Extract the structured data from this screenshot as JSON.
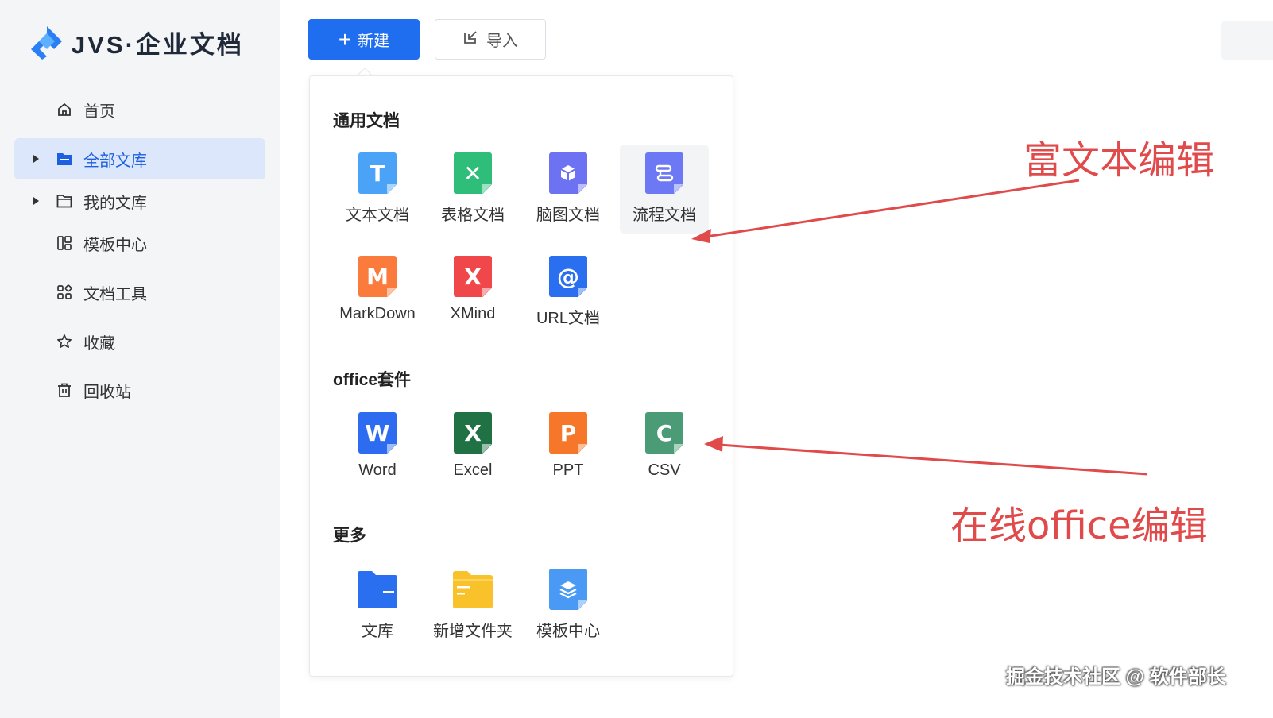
{
  "app": {
    "logo_text": "JVS·企业文档",
    "accent": "#1f6ef0"
  },
  "sidebar": {
    "items": [
      {
        "label": "首页",
        "icon": "home-icon"
      },
      {
        "label": "全部文库",
        "icon": "folder-filled-icon",
        "active": true
      },
      {
        "label": "我的文库",
        "icon": "folder-outline-icon"
      },
      {
        "label": "模板中心",
        "icon": "template-icon"
      },
      {
        "label": "文档工具",
        "icon": "tools-icon"
      },
      {
        "label": "收藏",
        "icon": "star-icon"
      },
      {
        "label": "回收站",
        "icon": "trash-icon"
      }
    ]
  },
  "toolbar": {
    "new_label": "新建",
    "new_icon": "+",
    "import_label": "导入"
  },
  "panel": {
    "sections": [
      {
        "title": "通用文档",
        "items": [
          {
            "label": "文本文档",
            "icon": "text-doc-icon",
            "color": "#4aa3f7"
          },
          {
            "label": "表格文档",
            "icon": "sheet-doc-icon",
            "color": "#2fbd7a"
          },
          {
            "label": "脑图文档",
            "icon": "mindmap-doc-icon",
            "color": "#6c72f2"
          },
          {
            "label": "流程文档",
            "icon": "flow-doc-icon",
            "color": "#6d78f4"
          },
          {
            "label": "MarkDown",
            "icon": "markdown-doc-icon",
            "color": "#fb7b3c"
          },
          {
            "label": "XMind",
            "icon": "xmind-doc-icon",
            "color": "#f0474a"
          },
          {
            "label": "URL文档",
            "icon": "url-doc-icon",
            "color": "#2a6ff0"
          }
        ]
      },
      {
        "title": "office套件",
        "items": [
          {
            "label": "Word",
            "icon": "word-icon",
            "color": "#2d6cf0"
          },
          {
            "label": "Excel",
            "icon": "excel-icon",
            "color": "#207245"
          },
          {
            "label": "PPT",
            "icon": "ppt-icon",
            "color": "#f7772a"
          },
          {
            "label": "CSV",
            "icon": "csv-icon",
            "color": "#4b9b76"
          }
        ]
      },
      {
        "title": "更多",
        "items": [
          {
            "label": "文库",
            "icon": "library-folder-icon",
            "color": "#2a6ff0"
          },
          {
            "label": "新增文件夹",
            "icon": "new-folder-icon",
            "color": "#f9c12a"
          },
          {
            "label": "模板中心",
            "icon": "template-layers-icon",
            "color": "#4a9af5"
          }
        ]
      }
    ]
  },
  "annotations": {
    "rich_text": "富文本编辑",
    "office": "在线office编辑",
    "color": "#e04a4a"
  },
  "watermark": "掘金技术社区 @ 软件部长"
}
